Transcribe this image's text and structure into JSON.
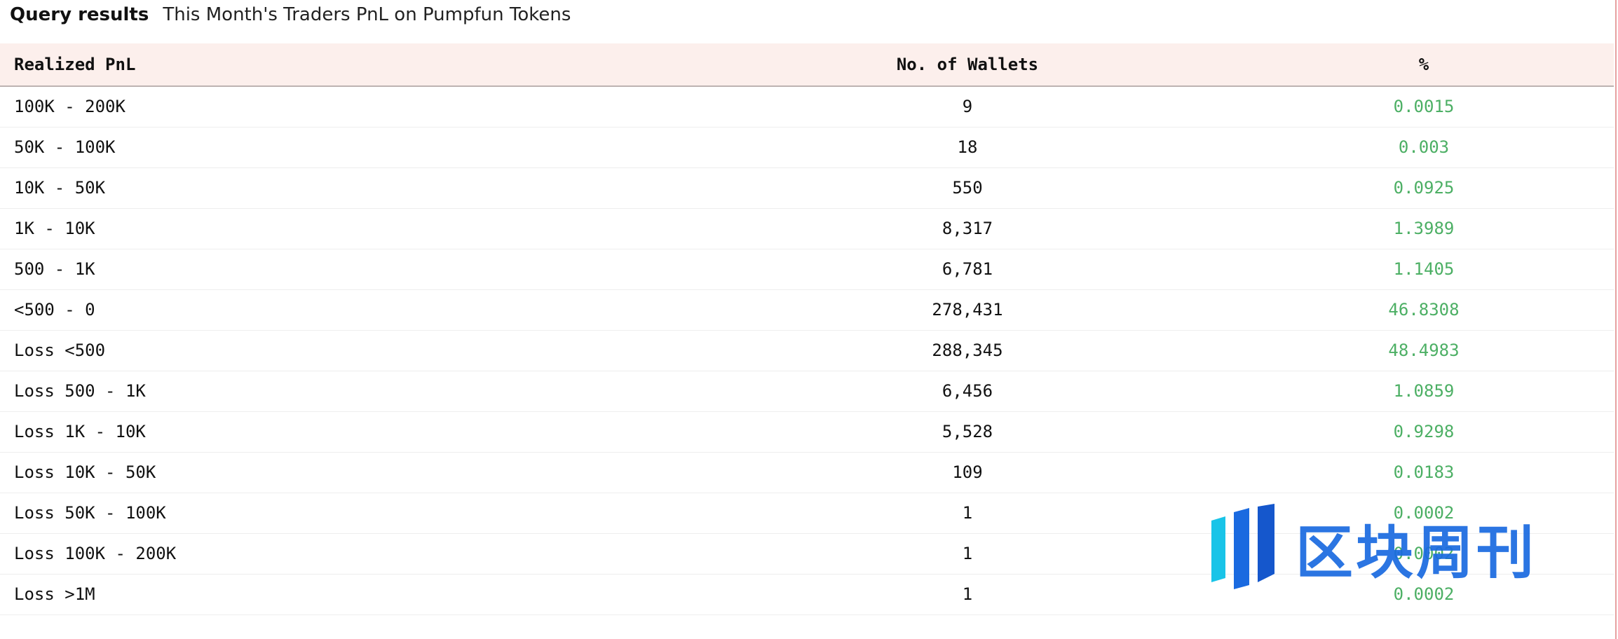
{
  "query": {
    "label": "Query results",
    "title": "This Month's Traders PnL on Pumpfun Tokens"
  },
  "table": {
    "columns": [
      "Realized PnL",
      "No. of Wallets",
      "%"
    ],
    "rows": [
      [
        "100K - 200K",
        "9",
        "0.0015"
      ],
      [
        "50K - 100K",
        "18",
        "0.003"
      ],
      [
        "10K - 50K",
        "550",
        "0.0925"
      ],
      [
        "1K - 10K",
        "8,317",
        "1.3989"
      ],
      [
        "500 - 1K",
        "6,781",
        "1.1405"
      ],
      [
        "<500 - 0",
        "278,431",
        "46.8308"
      ],
      [
        "Loss <500",
        "288,345",
        "48.4983"
      ],
      [
        "Loss 500 - 1K",
        "6,456",
        "1.0859"
      ],
      [
        "Loss 1K - 10K",
        "5,528",
        "0.9298"
      ],
      [
        "Loss 10K - 50K",
        "109",
        "0.0183"
      ],
      [
        "Loss 50K - 100K",
        "1",
        "0.0002"
      ],
      [
        "Loss 100K - 200K",
        "1",
        "0.0002"
      ],
      [
        "Loss >1M",
        "1",
        "0.0002"
      ]
    ]
  },
  "watermark": {
    "text": "区块周刊",
    "icon": "brand-logo-icon"
  },
  "colors": {
    "header_bg": "#fcefec",
    "percent_text": "#4caf64",
    "watermark_blue": "#1a6ae0",
    "watermark_cyan": "#19c4e8"
  }
}
